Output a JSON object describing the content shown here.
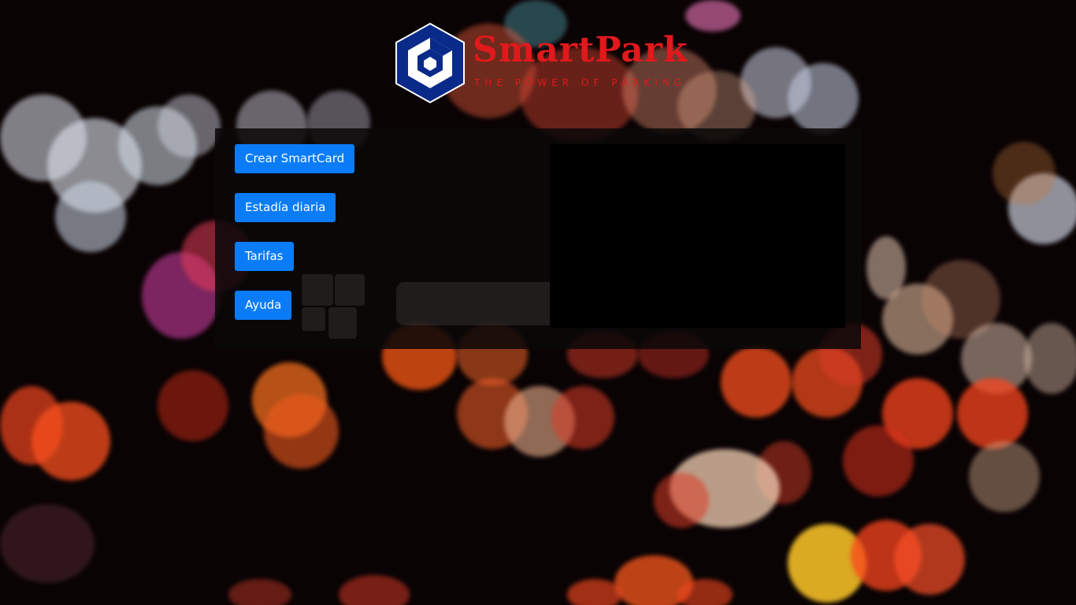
{
  "brand": {
    "name": "SmartPark",
    "tagline": "THE POWER OF PARKING"
  },
  "menu": {
    "items": [
      {
        "label": "Crear SmartCard"
      },
      {
        "label": "Estadía diaria"
      },
      {
        "label": "Tarifas"
      },
      {
        "label": "Ayuda"
      }
    ]
  },
  "colors": {
    "accent": "#0a7cf8",
    "brand_red": "#e0191c",
    "logo_blue": "#0a2a8a"
  }
}
